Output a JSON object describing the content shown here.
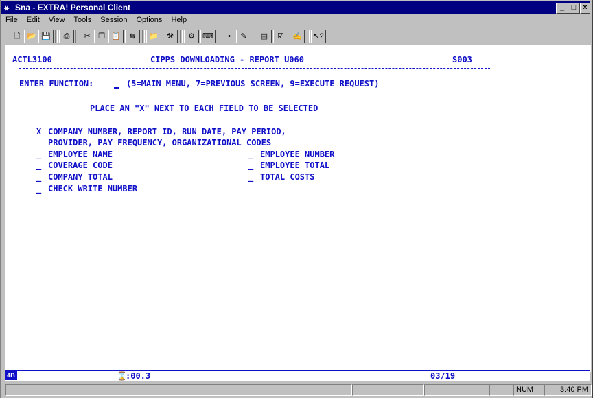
{
  "window": {
    "title": "Sna - EXTRA! Personal Client",
    "controls": {
      "minimize": "_",
      "maximize": "□",
      "close": "×"
    }
  },
  "menu": [
    "File",
    "Edit",
    "View",
    "Tools",
    "Session",
    "Options",
    "Help"
  ],
  "toolbar_icons": [
    "new-icon",
    "open-icon",
    "save-icon",
    "print-icon",
    "cut-icon",
    "copy-icon",
    "paste-icon",
    "send-file-icon",
    "receive-file-icon",
    "macro-icon",
    "settings-icon",
    "keyboard-icon",
    "hotspot-icon",
    "record-icon",
    "run-macro-icon",
    "edit-macro-icon",
    "toggle-icon",
    "quickpad-icon",
    "help-icon"
  ],
  "terminal": {
    "screen_id": "ACTL3100",
    "screen_title": "CIPPS DOWNLOADING - REPORT U060",
    "screen_code": "S003",
    "function_label": "ENTER FUNCTION:",
    "function_value": "",
    "function_options": "(5=MAIN MENU, 7=PREVIOUS SCREEN, 9=EXECUTE REQUEST)",
    "instruction": "PLACE AN \"X\" NEXT TO EACH FIELD TO BE SELECTED",
    "default_selected_mark": "X",
    "default_selected_line1": "COMPANY NUMBER, REPORT ID, RUN DATE, PAY PERIOD,",
    "default_selected_line2": "PROVIDER, PAY FREQUENCY, ORGANIZATIONAL CODES",
    "fields_left": [
      "EMPLOYEE NAME",
      "COVERAGE CODE",
      "COMPANY TOTAL",
      "CHECK WRITE NUMBER"
    ],
    "fields_right": [
      "EMPLOYEE NUMBER",
      "EMPLOYEE TOTAL",
      "TOTAL COSTS"
    ],
    "field_mark": "_"
  },
  "oia": {
    "indicator": "4B",
    "timer": ":00.3",
    "cursor_pos": "03/19"
  },
  "statusbar": {
    "num": "NUM",
    "time": "3:40 PM"
  }
}
